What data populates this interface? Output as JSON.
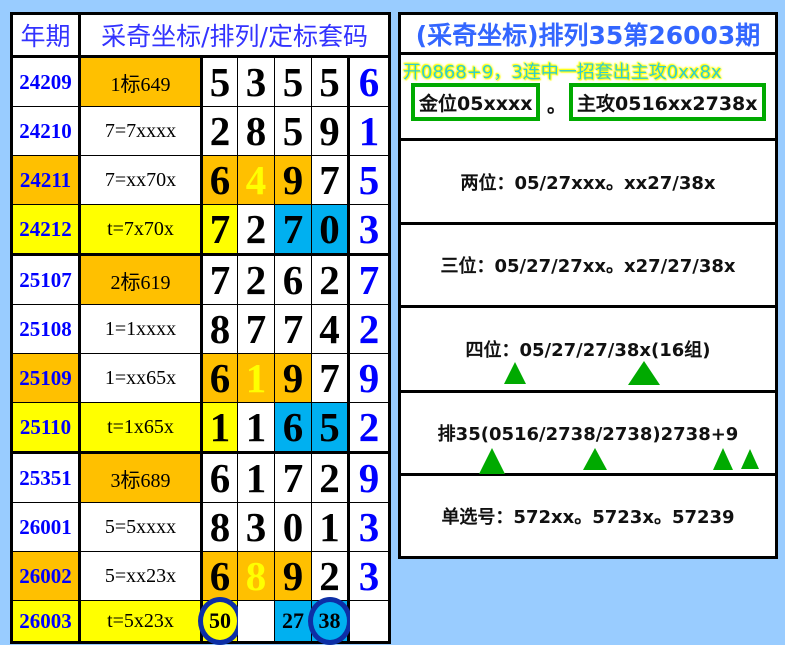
{
  "left": {
    "header": {
      "col1": "年期",
      "col2": "采奇坐标/排列/定标套码"
    },
    "rows": [
      {
        "period": "24209",
        "pbg": "w",
        "code": "1标649",
        "cbg": "o",
        "digits": [
          {
            "v": "5",
            "bg": "w"
          },
          {
            "v": "3",
            "bg": "w"
          },
          {
            "v": "5",
            "bg": "w"
          },
          {
            "v": "5",
            "bg": "w"
          }
        ],
        "last": "6"
      },
      {
        "period": "24210",
        "pbg": "w",
        "code": "7=7xxxx",
        "cbg": "w",
        "digits": [
          {
            "v": "2",
            "bg": "w"
          },
          {
            "v": "8",
            "bg": "w"
          },
          {
            "v": "5",
            "bg": "w"
          },
          {
            "v": "9",
            "bg": "w"
          }
        ],
        "last": "1"
      },
      {
        "period": "24211",
        "pbg": "o",
        "code": "7=xx70x",
        "cbg": "w",
        "digits": [
          {
            "v": "6",
            "bg": "o"
          },
          {
            "v": "4",
            "bg": "o",
            "yt": 1
          },
          {
            "v": "9",
            "bg": "o"
          },
          {
            "v": "7",
            "bg": "w"
          }
        ],
        "last": "5"
      },
      {
        "period": "24212",
        "pbg": "y",
        "code": "t=7x70x",
        "cbg": "y",
        "digits": [
          {
            "v": "7",
            "bg": "y"
          },
          {
            "v": "2",
            "bg": "w"
          },
          {
            "v": "7",
            "bg": "b"
          },
          {
            "v": "0",
            "bg": "b"
          }
        ],
        "last": "3"
      },
      {
        "period": "25107",
        "pbg": "w",
        "code": "2标619",
        "cbg": "o",
        "digits": [
          {
            "v": "7",
            "bg": "w"
          },
          {
            "v": "2",
            "bg": "w"
          },
          {
            "v": "6",
            "bg": "w"
          },
          {
            "v": "2",
            "bg": "w"
          }
        ],
        "last": "7"
      },
      {
        "period": "25108",
        "pbg": "w",
        "code": "1=1xxxx",
        "cbg": "w",
        "digits": [
          {
            "v": "8",
            "bg": "w"
          },
          {
            "v": "7",
            "bg": "w"
          },
          {
            "v": "7",
            "bg": "w"
          },
          {
            "v": "4",
            "bg": "w"
          }
        ],
        "last": "2"
      },
      {
        "period": "25109",
        "pbg": "o",
        "code": "1=xx65x",
        "cbg": "w",
        "digits": [
          {
            "v": "6",
            "bg": "o"
          },
          {
            "v": "1",
            "bg": "o",
            "yt": 1
          },
          {
            "v": "9",
            "bg": "o"
          },
          {
            "v": "7",
            "bg": "w"
          }
        ],
        "last": "9"
      },
      {
        "period": "25110",
        "pbg": "y",
        "code": "t=1x65x",
        "cbg": "y",
        "digits": [
          {
            "v": "1",
            "bg": "y"
          },
          {
            "v": "1",
            "bg": "w"
          },
          {
            "v": "6",
            "bg": "b"
          },
          {
            "v": "5",
            "bg": "b"
          }
        ],
        "last": "2"
      },
      {
        "period": "25351",
        "pbg": "w",
        "code": "3标689",
        "cbg": "o",
        "digits": [
          {
            "v": "6",
            "bg": "w"
          },
          {
            "v": "1",
            "bg": "w"
          },
          {
            "v": "7",
            "bg": "w"
          },
          {
            "v": "2",
            "bg": "w"
          }
        ],
        "last": "9"
      },
      {
        "period": "26001",
        "pbg": "w",
        "code": "5=5xxxx",
        "cbg": "w",
        "digits": [
          {
            "v": "8",
            "bg": "w"
          },
          {
            "v": "3",
            "bg": "w"
          },
          {
            "v": "0",
            "bg": "w"
          },
          {
            "v": "1",
            "bg": "w"
          }
        ],
        "last": "3"
      },
      {
        "period": "26002",
        "pbg": "o",
        "code": "5=xx23x",
        "cbg": "w",
        "digits": [
          {
            "v": "6",
            "bg": "o"
          },
          {
            "v": "8",
            "bg": "o",
            "yt": 1
          },
          {
            "v": "9",
            "bg": "o"
          },
          {
            "v": "2",
            "bg": "w"
          }
        ],
        "last": "3"
      },
      {
        "period": "26003",
        "pbg": "y",
        "code": "t=5x23x",
        "cbg": "y",
        "digits": [
          {
            "v": "50",
            "bg": "y",
            "circ": 1
          },
          {
            "v": "",
            "bg": "w"
          },
          {
            "v": "27",
            "bg": "b"
          },
          {
            "v": "38",
            "bg": "b",
            "circ": 1
          }
        ],
        "last": ""
      }
    ]
  },
  "right": {
    "title": "(采奇坐标)排列35第26003期",
    "note": "开0868+9，3连中一招套出主攻0xx8x",
    "box1": "金位05xxxx",
    "sep": "。",
    "box2": "主攻0516xx2738x",
    "two": "两位：05/27xxx。xx27/38x",
    "three": "三位：05/27/27xx。x27/27/38x",
    "four": "四位：05/27/27/38x(16组)",
    "pai": "排35(0516/2738/2738)2738+9",
    "single": "单选号：572xx。5723x。57239"
  },
  "colors": {
    "orange": "#ffc000",
    "yellow": "#ffff00",
    "blue": "#00b0f0",
    "green": "#00aa00"
  }
}
